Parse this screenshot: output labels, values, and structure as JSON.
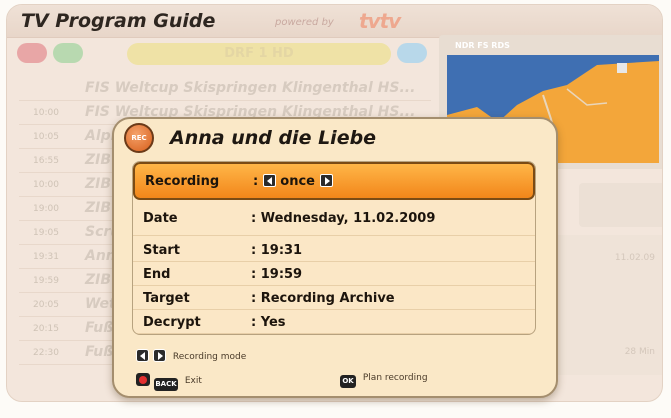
{
  "guide": {
    "title": "TV Program Guide",
    "powered_by": "powered by",
    "brand": "tvtv",
    "channel": "DRF 1 HD",
    "map_label": "NDR FS RDS",
    "listings": [
      {
        "time": "",
        "title": "FIS Weltcup Skispringen Klingenthal HS..."
      },
      {
        "time": "10:00",
        "title": "FIS Weltcup Skispringen Klingenthal HS..."
      },
      {
        "time": "10:05",
        "title": "Alpi"
      },
      {
        "time": "16:55",
        "title": "ZIB"
      },
      {
        "time": "10:00",
        "title": "ZIB"
      },
      {
        "time": "19:00",
        "title": "ZIB"
      },
      {
        "time": "19:05",
        "title": "Scru"
      },
      {
        "time": "19:31",
        "title": "Ann"
      },
      {
        "time": "19:59",
        "title": "ZIB"
      },
      {
        "time": "20:05",
        "title": "Wet"
      },
      {
        "time": "20:15",
        "title": "Fußb"
      },
      {
        "time": "22:30",
        "title": "Fußl"
      }
    ],
    "side_date": "11.02.09",
    "side_duration": "28 Min"
  },
  "dialog": {
    "badge": "REC",
    "title": "Anna und die Liebe",
    "recording_label": "Recording",
    "recording_value": "once",
    "rows": [
      {
        "label": "Date",
        "value": ": Wednesday, 11.02.2009"
      },
      {
        "label": "Start",
        "value": ": 19:31"
      },
      {
        "label": "End",
        "value": ": 19:59"
      },
      {
        "label": "Target",
        "value": ": Recording Archive"
      },
      {
        "label": "Decrypt",
        "value": ": Yes"
      }
    ],
    "hint_mode": "Recording mode",
    "hint_back_key": "BACK",
    "hint_exit": "Exit",
    "hint_ok_key": "OK",
    "hint_plan": "Plan recording"
  },
  "colors": {
    "accent": "#f2861a",
    "pill_red": "#e8a6a6",
    "pill_green": "#b8d9b0",
    "pill_blue": "#b8d8ea",
    "map_water": "#3f6fb2",
    "map_land": "#f3a63a"
  }
}
